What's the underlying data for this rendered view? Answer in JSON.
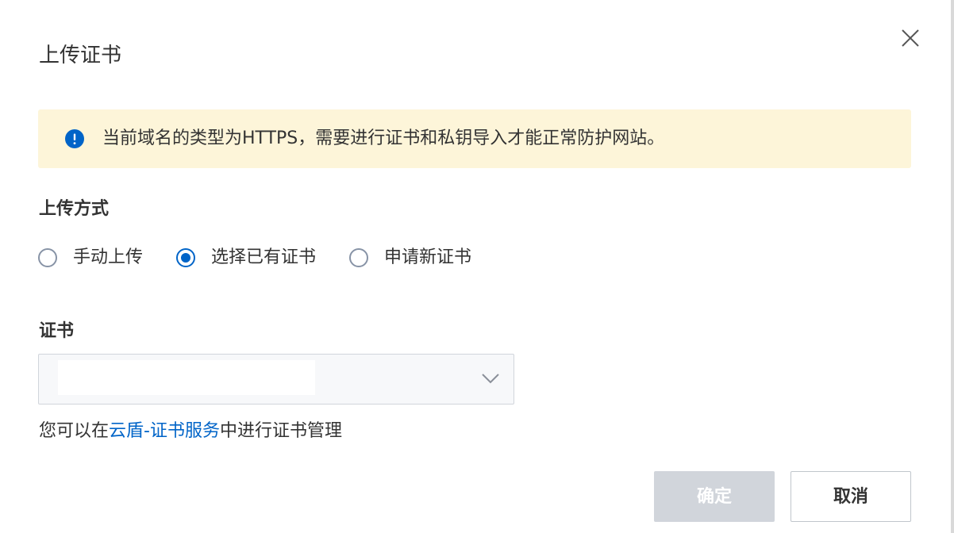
{
  "dialog": {
    "title": "上传证书",
    "close_icon": "close-icon"
  },
  "alert": {
    "icon": "info-exclamation-icon",
    "icon_color": "#0064c8",
    "background": "#fdf5d9",
    "text": "当前域名的类型为HTTPS，需要进行证书和私钥导入才能正常防护网站。"
  },
  "upload_method": {
    "label": "上传方式",
    "options": [
      {
        "label": "手动上传",
        "checked": false
      },
      {
        "label": "选择已有证书",
        "checked": true
      },
      {
        "label": "申请新证书",
        "checked": false
      }
    ]
  },
  "certificate": {
    "label": "证书",
    "selected_value": "",
    "arrow_icon": "chevron-down-icon"
  },
  "hint": {
    "prefix": "您可以在",
    "link": "云盾-证书服务",
    "suffix": "中进行证书管理"
  },
  "footer": {
    "ok_label": "确定",
    "ok_disabled": true,
    "cancel_label": "取消"
  },
  "colors": {
    "accent": "#0064c8",
    "disabled_button": "#d1d5db"
  }
}
